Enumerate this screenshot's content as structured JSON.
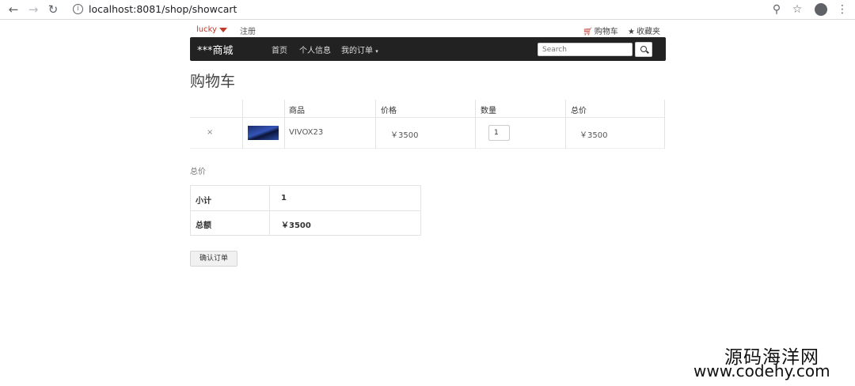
{
  "browser": {
    "url": "localhost:8081/shop/showcart"
  },
  "topbar": {
    "username": "lucky",
    "register": "注册",
    "cart": "购物车",
    "favorites": "收藏夹"
  },
  "navbar": {
    "brand": "***商城",
    "links": [
      "首页",
      "个人信息",
      "我的订单"
    ],
    "search_placeholder": "Search"
  },
  "page_title": "购物车",
  "cart_table": {
    "headers": [
      "商品",
      "价格",
      "数量",
      "总价"
    ],
    "rows": [
      {
        "remove": "×",
        "name": "VIVOX23",
        "price": "￥3500",
        "quantity": "1",
        "total": "￥3500"
      }
    ]
  },
  "totals": {
    "heading": "总价",
    "rows": [
      {
        "label": "小计",
        "value": "1"
      },
      {
        "label": "总额",
        "value": "￥3500"
      }
    ]
  },
  "confirm_button": "确认订单",
  "watermark": {
    "line1": "源码海洋网",
    "line2": "www.codehy.com"
  },
  "colors": {
    "navbar_bg": "#222222",
    "accent_red": "#c0392b"
  }
}
